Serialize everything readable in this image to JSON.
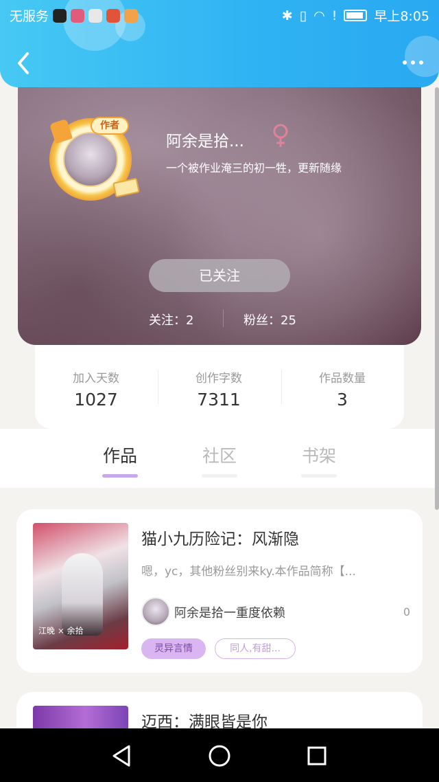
{
  "status_bar": {
    "carrier": "无服务",
    "time": "早上8:05"
  },
  "header": {
    "back_icon": "chevron-left-icon",
    "more_icon": "more-dots-icon"
  },
  "profile": {
    "author_badge": "作者",
    "name": "阿余是拾...",
    "gender_icon": "female-icon",
    "bio": "一个被作业淹三的初一牲，更新随缘",
    "follow_button": "已关注",
    "following": "关注：2",
    "fans": "粉丝：25"
  },
  "stats": [
    {
      "label": "加入天数",
      "value": "1027"
    },
    {
      "label": "创作字数",
      "value": "7311"
    },
    {
      "label": "作品数量",
      "value": "3"
    }
  ],
  "tabs": [
    {
      "label": "作品",
      "active": true
    },
    {
      "label": "社区",
      "active": false
    },
    {
      "label": "书架",
      "active": false
    }
  ],
  "works": [
    {
      "title": "猫小九历险记：风渐隐",
      "description": "嗯，yc，其他粉丝别来ky.本作品简称【...",
      "author": "阿余是拾一重度依赖",
      "count": "0",
      "tags": [
        "灵异言情",
        "同人,有甜..."
      ]
    },
    {
      "title": "迈西：满眼皆是你"
    }
  ],
  "colors": {
    "header_blue": "#2fb2f3",
    "accent_purple": "#c7a8ea",
    "tag_fill": "#d9b6f1"
  }
}
